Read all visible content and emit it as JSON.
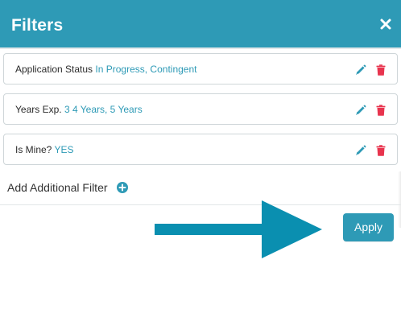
{
  "header": {
    "title": "Filters",
    "close_icon": "close-icon"
  },
  "filters": [
    {
      "label": "Application Status",
      "value": "In Progress, Contingent",
      "edit_icon": "pencil-icon",
      "delete_icon": "trash-icon"
    },
    {
      "label": "Years Exp.",
      "value": "3 4 Years, 5 Years",
      "edit_icon": "pencil-icon",
      "delete_icon": "trash-icon"
    },
    {
      "label": "Is Mine?",
      "value": "YES",
      "edit_icon": "pencil-icon",
      "delete_icon": "trash-icon"
    }
  ],
  "add_filter": {
    "label": "Add Additional Filter",
    "icon": "plus-circle-icon"
  },
  "annotation": {
    "icon": "arrow-right-icon",
    "color": "#0a8fb0"
  },
  "apply_button": {
    "label": "Apply"
  },
  "colors": {
    "accent": "#2e9ab6",
    "delete": "#e8344e",
    "text": "#2b2b2b"
  }
}
